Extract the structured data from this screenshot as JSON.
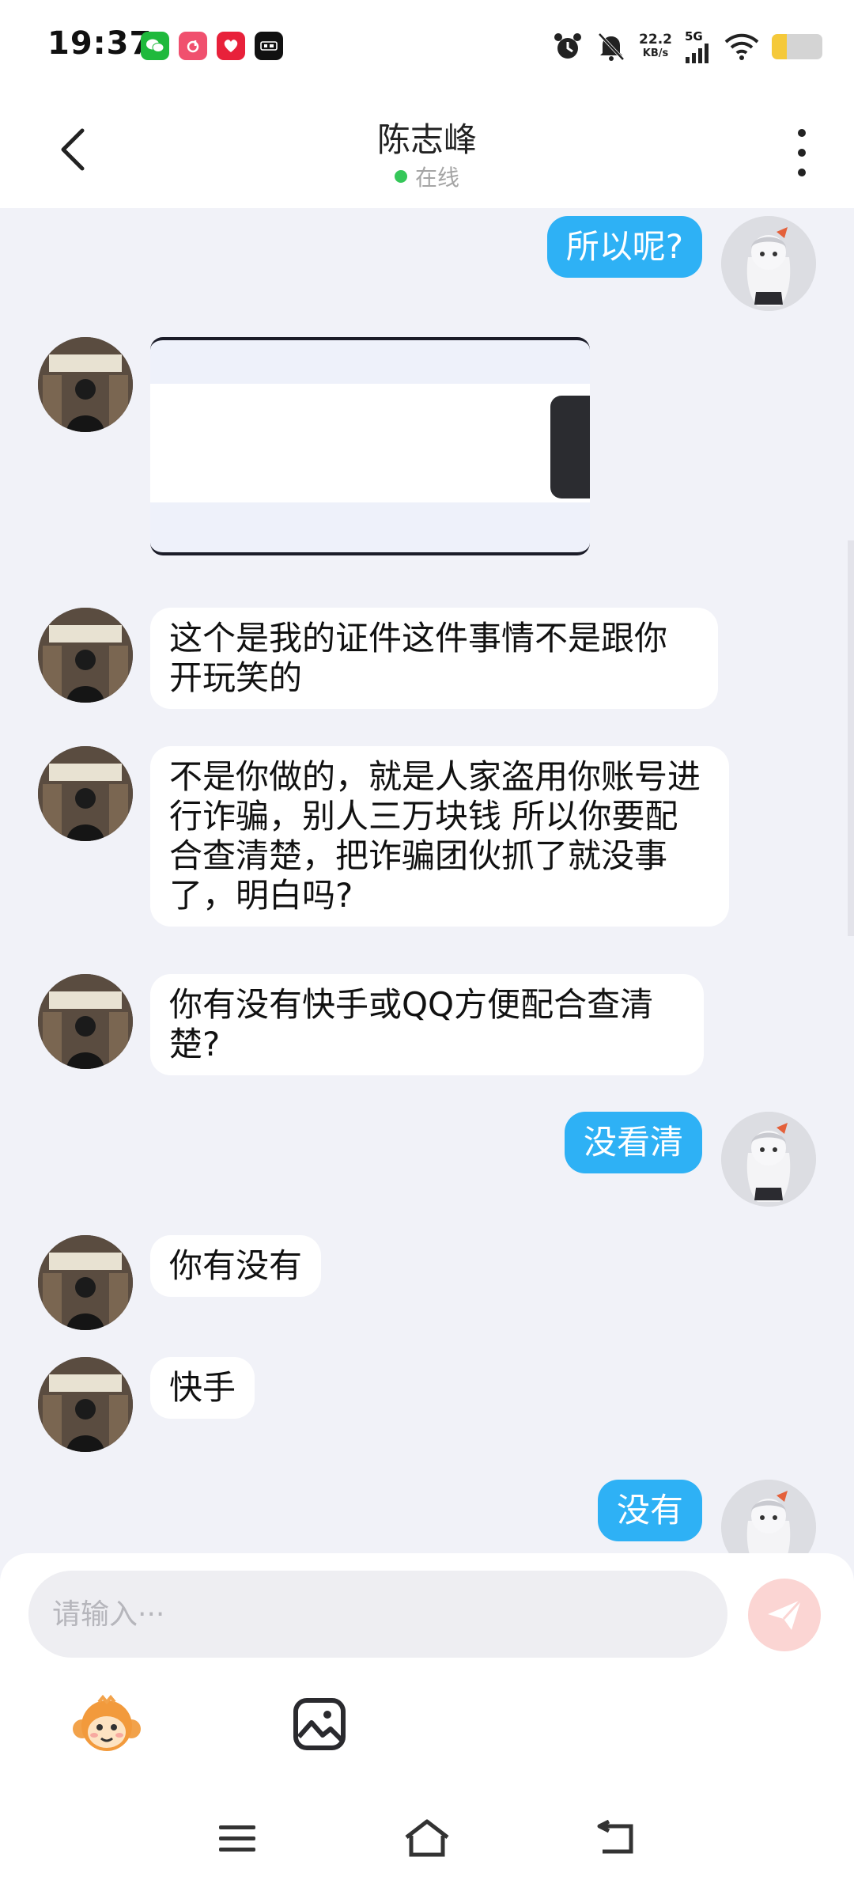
{
  "status_bar": {
    "time": "19:37",
    "network_speed_value": "22.2",
    "network_speed_unit": "KB/s",
    "network_type": "5G",
    "app_icons": [
      "wechat-icon",
      "music-icon",
      "love-app-icon",
      "video-app-icon"
    ],
    "battery_level": 0.3
  },
  "header": {
    "contact_name": "陈志峰",
    "status": "在线"
  },
  "messages": [
    {
      "from": "me",
      "text": "所以呢?"
    },
    {
      "from": "other",
      "type": "image"
    },
    {
      "from": "other",
      "text": "这个是我的证件这件事情不是跟你开玩笑的"
    },
    {
      "from": "other",
      "text": "不是你做的，就是人家盗用你账号进行诈骗，别人三万块钱 所以你要配合查清楚，把诈骗团伙抓了就没事了，明白吗?"
    },
    {
      "from": "other",
      "text": "你有没有快手或QQ方便配合查清楚?"
    },
    {
      "from": "me",
      "text": "没看清"
    },
    {
      "from": "other",
      "text": "你有没有"
    },
    {
      "from": "other",
      "text": "快手"
    },
    {
      "from": "me",
      "text": "没有"
    }
  ],
  "input": {
    "placeholder": "请输入···"
  },
  "colors": {
    "my_bubble": "#2eb1f5",
    "other_bubble": "#ffffff",
    "background": "#f1f2f8",
    "send_button": "#fbd5d3",
    "online_dot": "#35c759"
  }
}
